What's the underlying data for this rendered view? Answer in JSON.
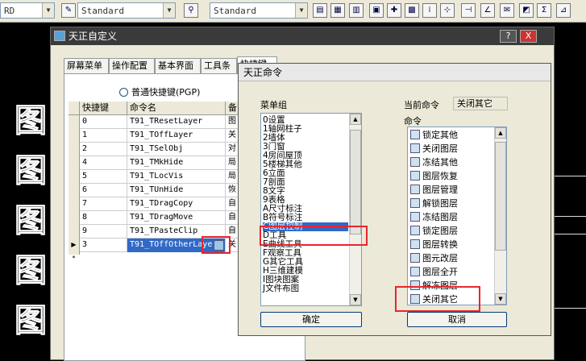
{
  "toolbar": {
    "combo1": "RD",
    "combo2": "Standard",
    "combo3": "Standard"
  },
  "cad_glyph": "图",
  "main_dialog": {
    "title": "天正自定义",
    "help_btn": "?",
    "close_btn": "X",
    "tabs": [
      "屏幕菜单",
      "操作配置",
      "基本界面",
      "工具条",
      "快捷键"
    ],
    "radio_label": "普通快捷键(PGP)",
    "grid": {
      "headers": [
        "快捷键",
        "命令名",
        "备"
      ],
      "rows": [
        {
          "key": "0",
          "cmd": "T91_TResetLayer",
          "desc": "图"
        },
        {
          "key": "1",
          "cmd": "T91_TOffLayer",
          "desc": "关"
        },
        {
          "key": "2",
          "cmd": "T91_TSelObj",
          "desc": "对"
        },
        {
          "key": "4",
          "cmd": "T91_TMkHide",
          "desc": "局"
        },
        {
          "key": "5",
          "cmd": "T91_TLocVis",
          "desc": "局"
        },
        {
          "key": "6",
          "cmd": "T91_TUnHide",
          "desc": "恢"
        },
        {
          "key": "7",
          "cmd": "T91_TDragCopy",
          "desc": "自"
        },
        {
          "key": "8",
          "cmd": "T91_TDragMove",
          "desc": "自"
        },
        {
          "key": "9",
          "cmd": "T91_TPasteClip",
          "desc": "自"
        },
        {
          "key": "3",
          "cmd": "T91_TOffOtherLayer",
          "desc": "关"
        }
      ],
      "new_row_marker": "*"
    }
  },
  "cmd_dialog": {
    "title": "天正命令",
    "menu_group_label": "菜单组",
    "current_cmd_label": "当前命令",
    "current_cmd_value": "关闭其它",
    "commands_label": "命令",
    "menu_groups": [
      "0设置",
      "1轴网柱子",
      "2墙体",
      "3门窗",
      "4房间屋顶",
      "5楼梯其他",
      "6立面",
      "7剖面",
      "8文字",
      "9表格",
      "A尺寸标注",
      "B符号标注",
      "C图层控制",
      "D工具",
      "E曲线工具",
      "F观察工具",
      "G其它工具",
      "H三维建模",
      "I图块图案",
      "J文件布图"
    ],
    "selected_group_index": 12,
    "commands": [
      "锁定其他",
      "关闭图层",
      "冻结其他",
      "图层恢复",
      "图层管理",
      "解锁图层",
      "冻结图层",
      "锁定图层",
      "图层转换",
      "图元改层",
      "图层全开",
      "解冻图层",
      "关闭其它"
    ],
    "ok_label": "确定",
    "cancel_label": "取消"
  },
  "colors": {
    "selection": "#3169c6",
    "highlight_box": "#e8262d",
    "dialog_bg": "#ece9d8"
  }
}
